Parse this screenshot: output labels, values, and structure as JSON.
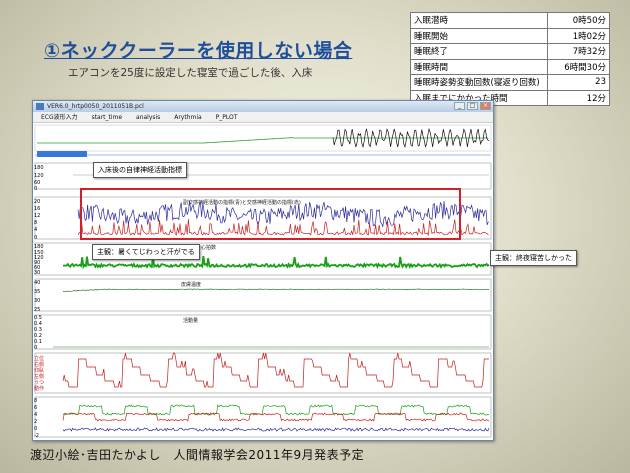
{
  "slide": {
    "title": "①ネッククーラーを使用しない場合",
    "subtitle": "エアコンを25度に設定した寝室で過ごした後、入床",
    "footer": "渡辺小絵･吉田たかよし　人間情報学会2011年9月発表予定"
  },
  "sleep_table": [
    {
      "label": "入眠潜時",
      "value": "0時50分"
    },
    {
      "label": "睡眠開始",
      "value": "1時02分"
    },
    {
      "label": "睡眠終了",
      "value": "7時32分"
    },
    {
      "label": "睡眠時間",
      "value": "6時間30分"
    },
    {
      "label": "睡眠時姿勢変動回数(寝返り回数)",
      "value": "23"
    },
    {
      "label": "入眠までにかかった時間",
      "value": "12分"
    }
  ],
  "window": {
    "title": "VER6.0_hrtp0050_2011051B.pcl",
    "controls": [
      "_",
      "□",
      "×"
    ],
    "menu": [
      "ECG波形入力",
      "start_time",
      "analysis",
      "Arythmia",
      "P_PLOT"
    ]
  },
  "callouts": {
    "autonomic": "入床後の自律神経活動指標",
    "main1": "主観：暑くてじわっと汗がでる",
    "main2": "主観：終夜寝苦しかった"
  },
  "panels": {
    "autonomic_title": "副交感神経活動の指標(青)と交感神経活動の指標(赤)",
    "hr_title": "心拍数",
    "temp_title": "皮膚温度",
    "activity_title": "活動量",
    "posture_labels": [
      "立位",
      "右側",
      "仰臥",
      "左側",
      "うつ",
      "動作"
    ]
  },
  "axes": {
    "ecg_top": [
      "180",
      "120",
      "60",
      "0"
    ],
    "autonomic": [
      "20",
      "16",
      "12",
      "8",
      "4",
      "0"
    ],
    "hr": [
      "180",
      "150",
      "120",
      "90",
      "60",
      "30"
    ],
    "temp": [
      "40",
      "35",
      "30",
      "25"
    ],
    "activity": [
      "0.5",
      "0.4",
      "0.3",
      "0.2",
      "0.1",
      "0"
    ],
    "bottom": [
      "8",
      "6",
      "4",
      "2",
      "0",
      "-2"
    ]
  },
  "colors": {
    "title_blue": "#1e4e9c",
    "highlight_red": "#d0202a",
    "parasympathetic": "#2a2a9c",
    "sympathetic": "#cc2020",
    "heart_rate": "#18a018"
  }
}
